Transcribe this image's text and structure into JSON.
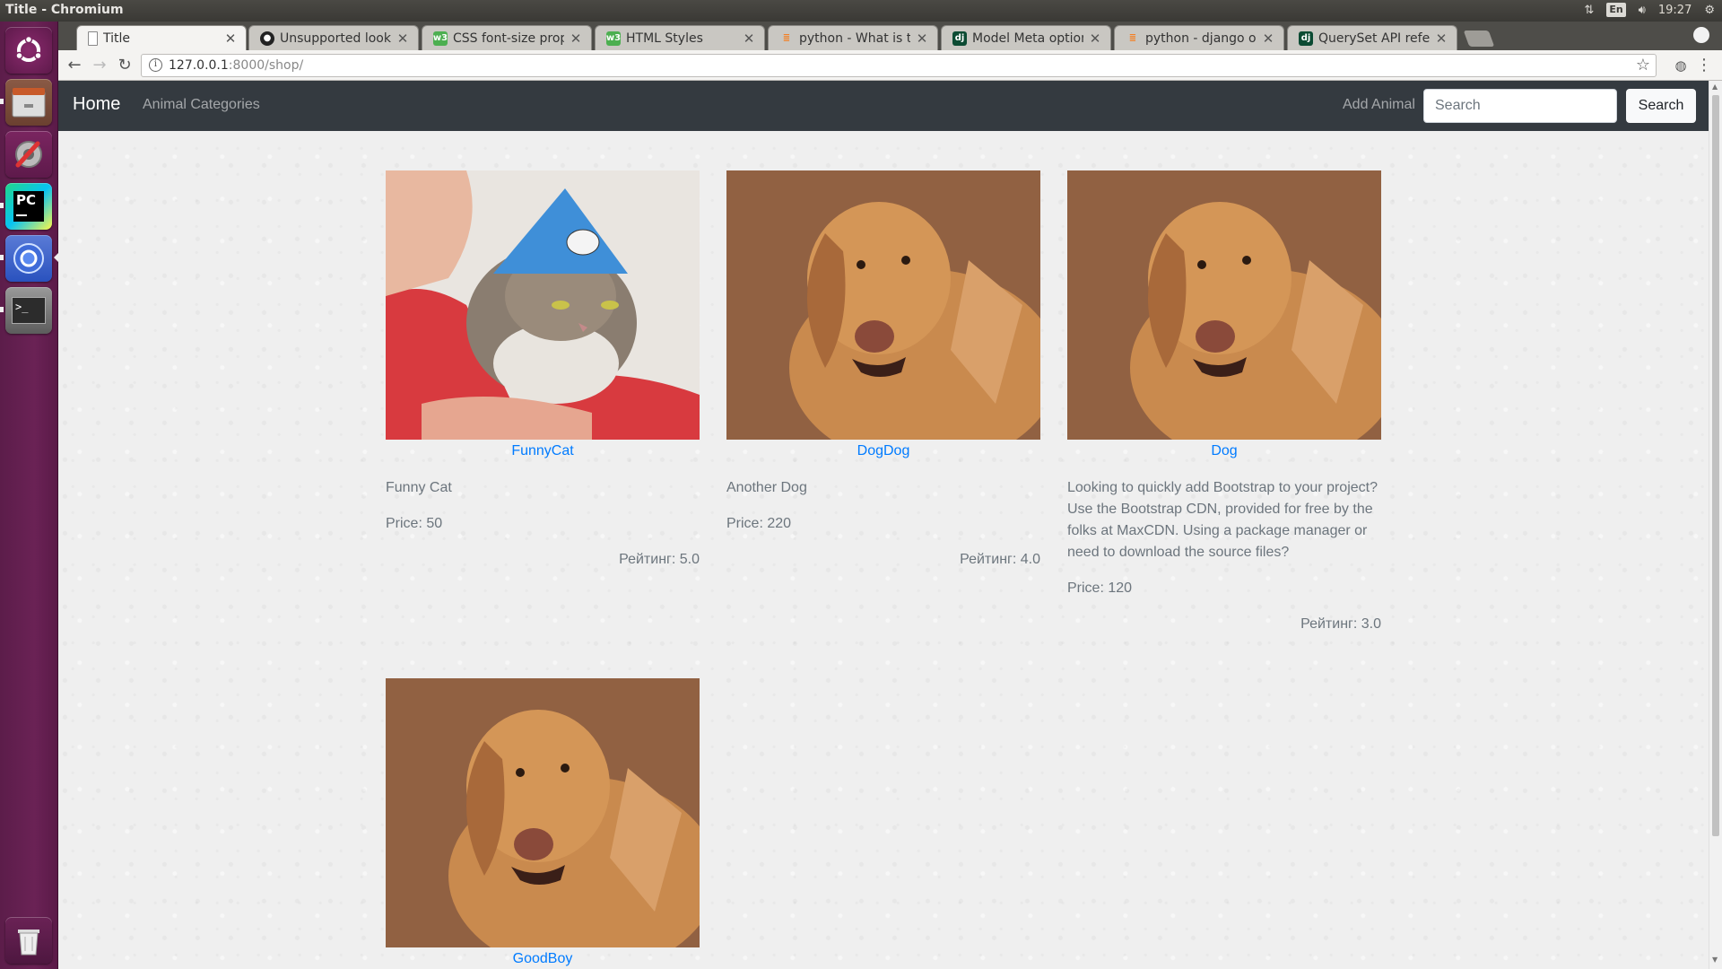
{
  "window": {
    "title": "Title - Chromium"
  },
  "tray": {
    "lang": "En",
    "time": "19:27"
  },
  "tabs": [
    {
      "title": "Title",
      "favicon": "page-icon"
    },
    {
      "title": "Unsupported looku",
      "favicon": "github-icon"
    },
    {
      "title": "CSS font-size prope",
      "favicon": "w3schools-icon"
    },
    {
      "title": "HTML Styles",
      "favicon": "w3schools-icon"
    },
    {
      "title": "python - What is th",
      "favicon": "stackoverflow-icon"
    },
    {
      "title": "Model Meta option",
      "favicon": "django-icon"
    },
    {
      "title": "python - django or",
      "favicon": "stackoverflow-icon"
    },
    {
      "title": "QuerySet API refer",
      "favicon": "django-icon"
    }
  ],
  "address": {
    "host": "127.0.0.1",
    "rest": ":8000/shop/"
  },
  "navbar": {
    "brand": "Home",
    "categories": "Animal Categories",
    "add": "Add Animal",
    "search_placeholder": "Search",
    "search_button": "Search"
  },
  "animals": [
    {
      "name": "FunnyCat",
      "description": "Funny Cat",
      "price": "Price: 50",
      "rating": "Рейтинг: 5.0",
      "image": "cat-photo"
    },
    {
      "name": "DogDog",
      "description": "Another Dog",
      "price": "Price: 220",
      "rating": "Рейтинг: 4.0",
      "image": "dog-photo"
    },
    {
      "name": "Dog",
      "description": "Looking to quickly add Bootstrap to your project? Use the Bootstrap CDN, provided for free by the folks at MaxCDN. Using a package manager or need to download the source files?",
      "price": "Price: 120",
      "rating": "Рейтинг: 3.0",
      "image": "dog-photo"
    },
    {
      "name": "GoodBoy",
      "image": "dog-photo"
    }
  ]
}
